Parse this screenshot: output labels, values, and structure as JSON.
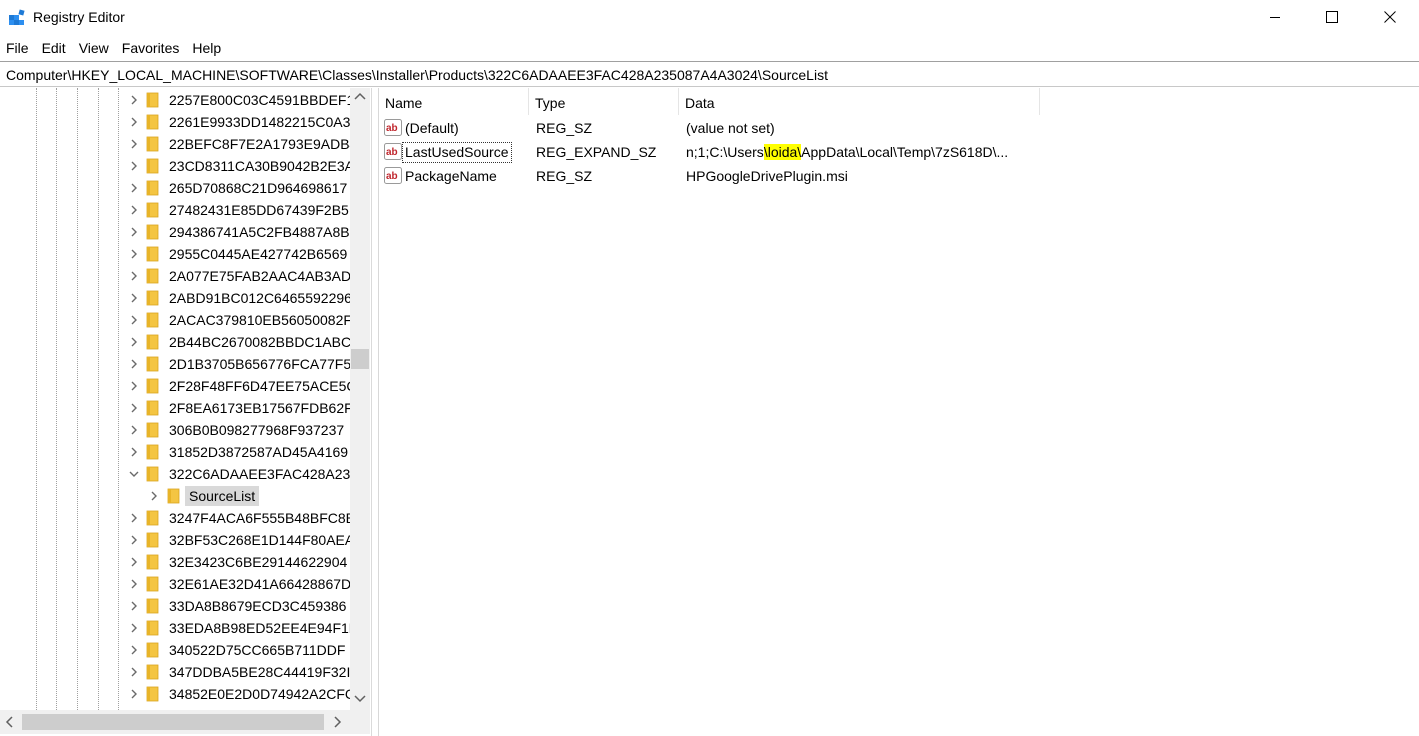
{
  "window": {
    "title": "Registry Editor",
    "icon": "registry-editor-icon"
  },
  "menu": {
    "file": "File",
    "edit": "Edit",
    "view": "View",
    "favorites": "Favorites",
    "help": "Help"
  },
  "address": {
    "path": "Computer\\HKEY_LOCAL_MACHINE\\SOFTWARE\\Classes\\Installer\\Products\\322C6ADAAEE3FAC428A235087A4A3024\\SourceList"
  },
  "tree": {
    "items": [
      {
        "label": "2257E800C03C4591BBDEF1",
        "state": "collapsed"
      },
      {
        "label": "2261E9933DD1482215C0A3",
        "state": "collapsed"
      },
      {
        "label": "22BEFC8F7E2A1793E9ADB4",
        "state": "collapsed"
      },
      {
        "label": "23CD8311CA30B9042B2E3A",
        "state": "collapsed"
      },
      {
        "label": "265D70868C21D964698617",
        "state": "collapsed"
      },
      {
        "label": "27482431E85DD67439F2B5",
        "state": "collapsed"
      },
      {
        "label": "294386741A5C2FB4887A8B",
        "state": "collapsed"
      },
      {
        "label": "2955C0445AE427742B6569",
        "state": "collapsed"
      },
      {
        "label": "2A077E75FAB2AAC4AB3AD",
        "state": "collapsed"
      },
      {
        "label": "2ABD91BC012C6465592296",
        "state": "collapsed"
      },
      {
        "label": "2ACAC379810EB56050082F",
        "state": "collapsed"
      },
      {
        "label": "2B44BC2670082BBDC1ABC",
        "state": "collapsed"
      },
      {
        "label": "2D1B3705B656776FCA77F5",
        "state": "collapsed"
      },
      {
        "label": "2F28F48FF6D47EE75ACE5C",
        "state": "collapsed"
      },
      {
        "label": "2F8EA6173EB17567FDB62F",
        "state": "collapsed"
      },
      {
        "label": "306B0B098277968F937237",
        "state": "collapsed"
      },
      {
        "label": "31852D3872587AD45A4169",
        "state": "collapsed"
      },
      {
        "label": "322C6ADAAEE3FAC428A23",
        "state": "expanded"
      },
      {
        "label": "SourceList",
        "state": "selected-child"
      },
      {
        "label": "3247F4ACA6F555B48BFC8B",
        "state": "collapsed"
      },
      {
        "label": "32BF53C268E1D144F80AEA",
        "state": "collapsed"
      },
      {
        "label": "32E3423C6BE29144622904",
        "state": "collapsed"
      },
      {
        "label": "32E61AE32D41A66428867D",
        "state": "collapsed"
      },
      {
        "label": "33DA8B8679ECD3C459386",
        "state": "collapsed"
      },
      {
        "label": "33EDA8B98ED52EE4E94F1E",
        "state": "collapsed"
      },
      {
        "label": "340522D75CC665B711DDF",
        "state": "collapsed"
      },
      {
        "label": "347DDBA5BE28C44419F32I",
        "state": "collapsed"
      },
      {
        "label": "34852E0E2D0D74942A2CFC",
        "state": "collapsed"
      }
    ]
  },
  "values": {
    "columns": {
      "name": "Name",
      "type": "Type",
      "data": "Data"
    },
    "rows": [
      {
        "name": "(Default)",
        "type": "REG_SZ",
        "data": "(value not set)",
        "icon": "string-value-icon"
      },
      {
        "name": "LastUsedSource",
        "type": "REG_EXPAND_SZ",
        "data_prefix": "n;1;C:\\Users",
        "data_highlight": "\\loida\\",
        "data_suffix": "AppData\\Local\\Temp\\7zS618D\\...",
        "icon": "string-value-icon"
      },
      {
        "name": "PackageName",
        "type": "REG_SZ",
        "data": "HPGoogleDrivePlugin.msi",
        "icon": "string-value-icon"
      }
    ]
  },
  "colors": {
    "highlight": "#ffff00",
    "folder": "#f4c542",
    "selected_bg": "#d9d9d9"
  }
}
